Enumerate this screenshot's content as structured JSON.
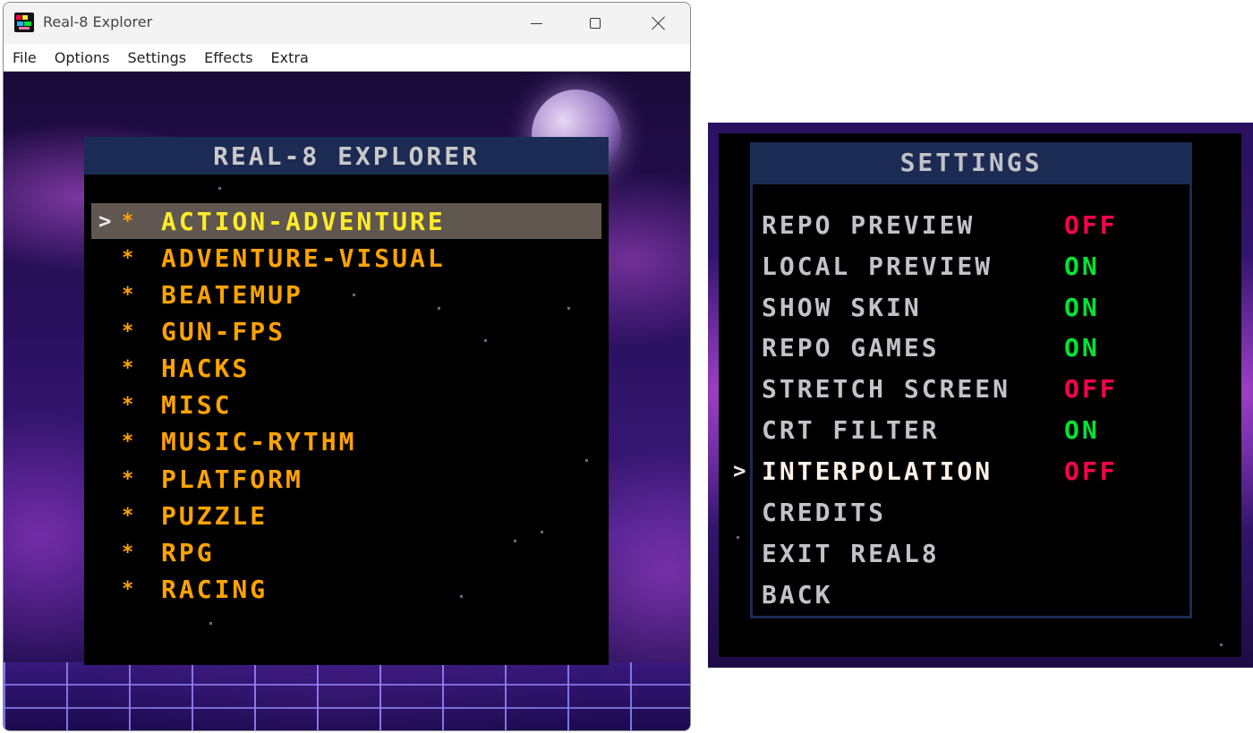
{
  "window": {
    "title": "Real-8 Explorer",
    "menu": [
      "File",
      "Options",
      "Settings",
      "Effects",
      "Extra"
    ]
  },
  "explorer": {
    "title": "REAL-8 EXPLORER",
    "cursor": ">",
    "bullet": "*",
    "categories": [
      {
        "label": "ACTION-ADVENTURE",
        "selected": true
      },
      {
        "label": "ADVENTURE-VISUAL",
        "selected": false
      },
      {
        "label": "BEATEMUP",
        "selected": false
      },
      {
        "label": "GUN-FPS",
        "selected": false
      },
      {
        "label": "HACKS",
        "selected": false
      },
      {
        "label": "MISC",
        "selected": false
      },
      {
        "label": "MUSIC-RYTHM",
        "selected": false
      },
      {
        "label": "PLATFORM",
        "selected": false
      },
      {
        "label": "PUZZLE",
        "selected": false
      },
      {
        "label": "RPG",
        "selected": false
      },
      {
        "label": "RACING",
        "selected": false
      }
    ]
  },
  "settings": {
    "title": "SETTINGS",
    "cursor": ">",
    "items": [
      {
        "label": "REPO PREVIEW",
        "value": "OFF"
      },
      {
        "label": "LOCAL PREVIEW",
        "value": "ON"
      },
      {
        "label": "SHOW SKIN",
        "value": "ON"
      },
      {
        "label": "REPO GAMES",
        "value": "ON"
      },
      {
        "label": "STRETCH SCREEN",
        "value": "OFF"
      },
      {
        "label": "CRT FILTER",
        "value": "ON"
      },
      {
        "label": "INTERPOLATION",
        "value": "OFF",
        "selected": true
      },
      {
        "label": "CREDITS",
        "value": ""
      },
      {
        "label": "EXIT REAL8",
        "value": ""
      },
      {
        "label": "BACK",
        "value": ""
      }
    ]
  },
  "colors": {
    "panel_header": "#1c2b53",
    "category_text": "#ffa300",
    "selected_text": "#ffec27",
    "selected_bg": "#5f5750",
    "on": "#00e436",
    "off": "#ff004d"
  }
}
